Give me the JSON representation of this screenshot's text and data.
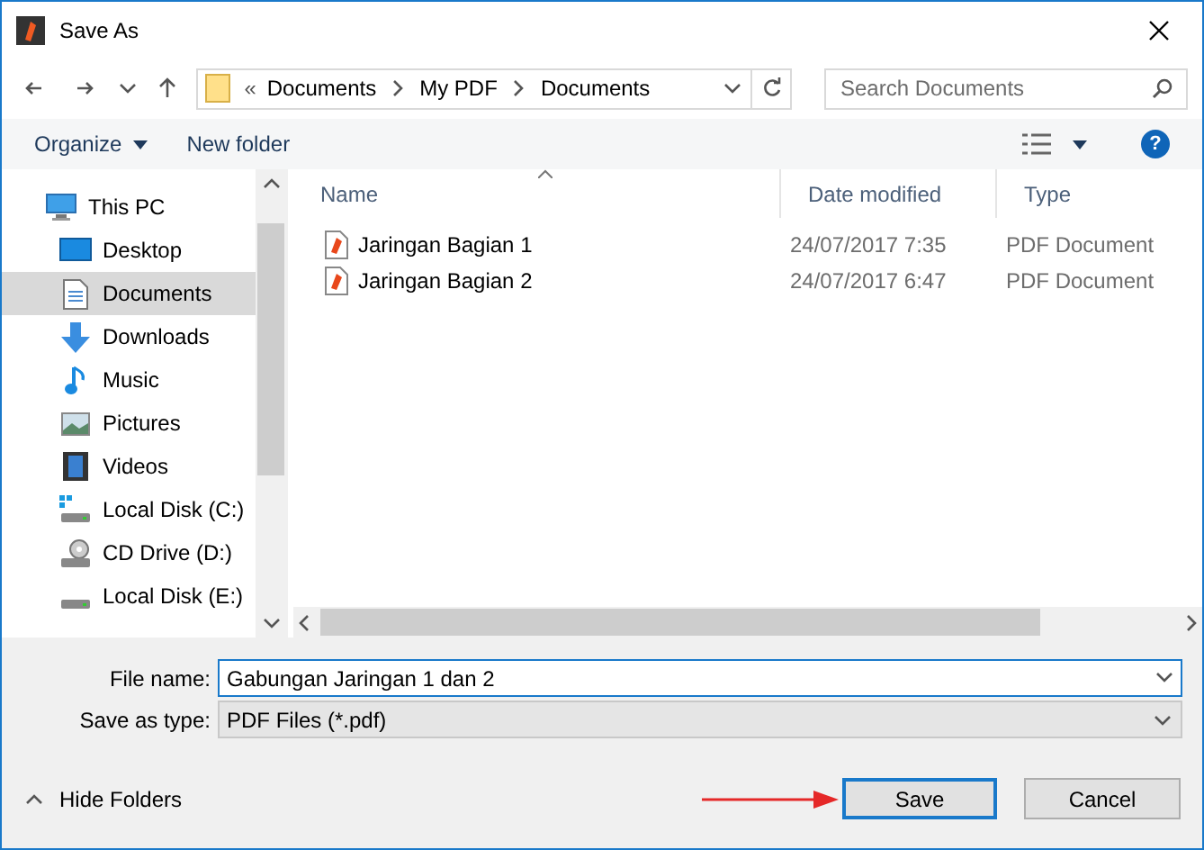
{
  "window": {
    "title": "Save As"
  },
  "address": {
    "overflow": "«",
    "crumbs": [
      "Documents",
      "My PDF",
      "Documents"
    ]
  },
  "search": {
    "placeholder": "Search Documents"
  },
  "toolbar": {
    "organize": "Organize",
    "new_folder": "New folder",
    "help": "?"
  },
  "sidebar": {
    "items": [
      {
        "label": "This PC",
        "selected": false,
        "children": [
          {
            "label": "Desktop",
            "selected": false
          },
          {
            "label": "Documents",
            "selected": true
          },
          {
            "label": "Downloads",
            "selected": false
          },
          {
            "label": "Music",
            "selected": false
          },
          {
            "label": "Pictures",
            "selected": false
          },
          {
            "label": "Videos",
            "selected": false
          },
          {
            "label": "Local Disk (C:)",
            "selected": false
          },
          {
            "label": "CD Drive (D:)",
            "selected": false
          },
          {
            "label": "Local Disk (E:)",
            "selected": false
          }
        ]
      }
    ]
  },
  "table": {
    "columns": [
      "Name",
      "Date modified",
      "Type"
    ],
    "rows": [
      {
        "name": "Jaringan Bagian 1",
        "date": "24/07/2017 7:35",
        "type": "PDF Document"
      },
      {
        "name": "Jaringan Bagian 2",
        "date": "24/07/2017 6:47",
        "type": "PDF Document"
      }
    ]
  },
  "form": {
    "file_name_label": "File name:",
    "file_name": "Gabungan Jaringan 1 dan 2",
    "type_label": "Save as type:",
    "type": "PDF Files (*.pdf)"
  },
  "footer": {
    "hide_folders": "Hide Folders",
    "save": "Save",
    "cancel": "Cancel"
  }
}
